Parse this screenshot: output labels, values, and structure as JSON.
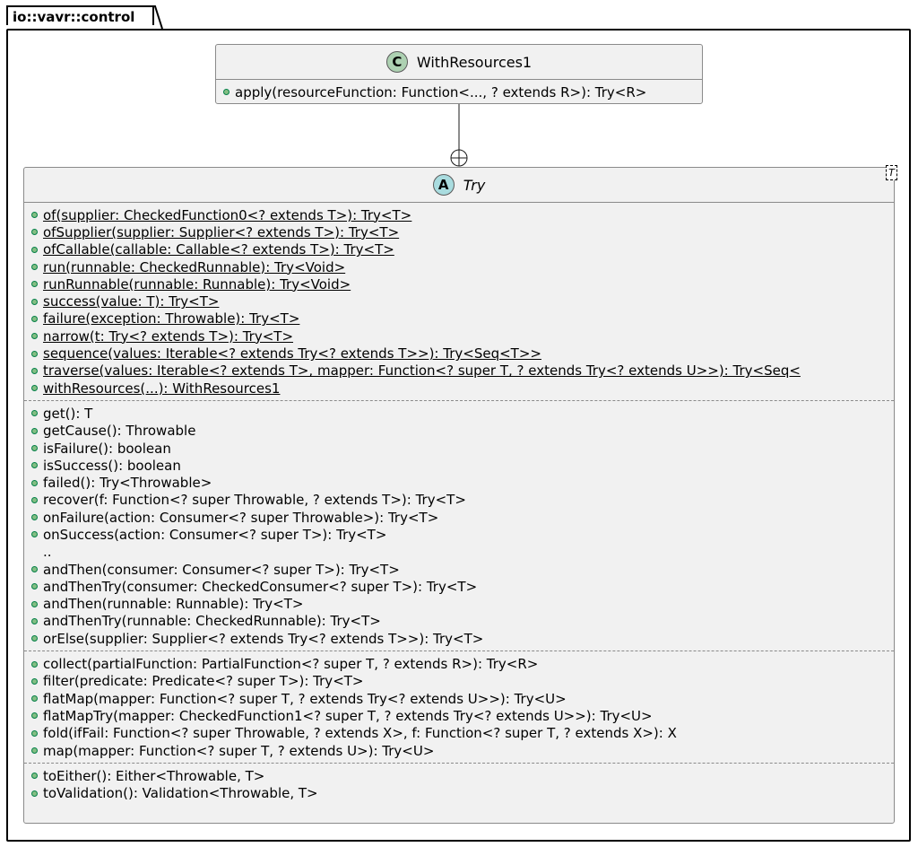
{
  "package": {
    "name": "io::vavr::control"
  },
  "with_resources": {
    "stereotype": "C",
    "name": "WithResources1",
    "members": [
      {
        "text": "apply(resourceFunction: Function<..., ? extends R>): Try<R>"
      }
    ]
  },
  "try_class": {
    "stereotype": "A",
    "name": "Try",
    "type_param": "T",
    "static_members": [
      "of(supplier: CheckedFunction0<? extends T>): Try<T>",
      "ofSupplier(supplier: Supplier<? extends T>): Try<T>",
      "ofCallable(callable: Callable<? extends T>): Try<T>",
      "run(runnable: CheckedRunnable): Try<Void>",
      "runRunnable(runnable: Runnable): Try<Void>",
      "success(value: T): Try<T>",
      "failure(exception: Throwable): Try<T>",
      "narrow(t: Try<? extends T>): Try<T>",
      "sequence(values: Iterable<? extends Try<? extends T>>): Try<Seq<T>>",
      "traverse(values: Iterable<? extends T>, mapper: Function<? super T, ? extends Try<? extends U>>): Try<Seq<",
      "withResources(...): WithResources1"
    ],
    "instance_members": [
      "get(): T",
      "getCause(): Throwable",
      "isFailure(): boolean",
      "isSuccess(): boolean",
      "failed(): Try<Throwable>",
      "recover(f: Function<? super Throwable, ? extends T>): Try<T>",
      "onFailure(action: Consumer<? super Throwable>): Try<T>",
      "onSuccess(action: Consumer<? super T>): Try<T>",
      "..",
      "andThen(consumer: Consumer<? super T>): Try<T>",
      "andThenTry(consumer: CheckedConsumer<? super T>): Try<T>",
      "andThen(runnable: Runnable): Try<T>",
      "andThenTry(runnable: CheckedRunnable): Try<T>",
      "orElse(supplier: Supplier<? extends Try<? extends T>>): Try<T>"
    ],
    "transform_members": [
      "collect(partialFunction: PartialFunction<? super T, ? extends R>): Try<R>",
      "filter(predicate: Predicate<? super T>): Try<T>",
      "flatMap(mapper: Function<? super T, ? extends Try<? extends U>>): Try<U>",
      "flatMapTry(mapper: CheckedFunction1<? super T, ? extends Try<? extends U>>): Try<U>",
      "fold(ifFail: Function<? super Throwable, ? extends X>, f: Function<? super T, ? extends X>): X",
      "map(mapper: Function<? super T, ? extends U>): Try<U>"
    ],
    "conversion_members": [
      "toEither(): Either<Throwable, T>",
      "toValidation(): Validation<Throwable, T>"
    ]
  },
  "colors": {
    "class_stereotype": "#add1b2",
    "abstract_stereotype": "#a9dcdf",
    "visibility_public": "#84be84",
    "box_fill": "#f1f1f1"
  }
}
